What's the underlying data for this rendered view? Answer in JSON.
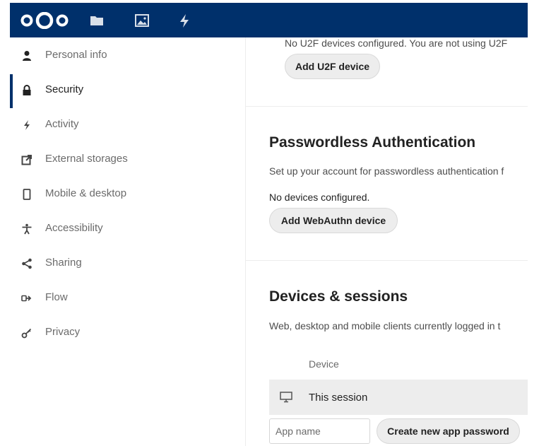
{
  "header": {
    "icons": [
      "nextcloud-logo",
      "files-icon",
      "photos-icon",
      "activity-icon"
    ]
  },
  "sidebar": {
    "items": [
      {
        "label": "Personal info",
        "icon": "person-icon"
      },
      {
        "label": "Security",
        "icon": "lock-icon",
        "active": true
      },
      {
        "label": "Activity",
        "icon": "lightning-icon"
      },
      {
        "label": "External storages",
        "icon": "external-link-icon"
      },
      {
        "label": "Mobile & desktop",
        "icon": "phone-icon"
      },
      {
        "label": "Accessibility",
        "icon": "accessibility-icon"
      },
      {
        "label": "Sharing",
        "icon": "share-icon"
      },
      {
        "label": "Flow",
        "icon": "flow-icon"
      },
      {
        "label": "Privacy",
        "icon": "key-icon"
      }
    ]
  },
  "u2f": {
    "status": "No U2F devices configured. You are not using U2F",
    "button": "Add U2F device"
  },
  "passwordless": {
    "title": "Passwordless Authentication",
    "description": "Set up your account for passwordless authentication f",
    "status": "No devices configured.",
    "button": "Add WebAuthn device"
  },
  "devices": {
    "title": "Devices & sessions",
    "description": "Web, desktop and mobile clients currently logged in t",
    "column_header": "Device",
    "session_label": "This session",
    "app_name_placeholder": "App name",
    "create_button": "Create new app password"
  },
  "colors": {
    "header": "#00306b",
    "active_indicator": "#00306b",
    "button_bg": "#ededed"
  }
}
